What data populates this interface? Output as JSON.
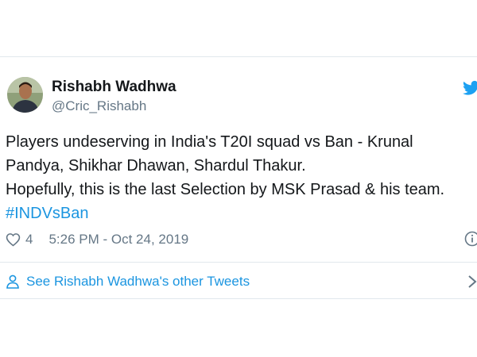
{
  "tweet": {
    "author_name": "Rishabh Wadhwa",
    "handle": "@Cric_Rishabh",
    "text_lines": [
      "Players undeserving in India's T20I squad vs Ban - Krunal",
      "Pandya, Shikhar Dhawan, Shardul Thakur.",
      "Hopefully, this is the last Selection by MSK Prasad & his team."
    ],
    "hashtag": "#INDVsBan",
    "like_count": "4",
    "timestamp": "5:26 PM - Oct 24, 2019",
    "other_tweets_link": "See Rishabh Wadhwa's other Tweets"
  },
  "icons": {
    "brand": "twitter-bird-icon",
    "like": "heart-icon",
    "info": "info-icon",
    "profile": "person-icon",
    "more": "chevron-right-icon"
  },
  "colors": {
    "brand": "#1da1f2",
    "link": "#1b95e0",
    "secondary_text": "#657786",
    "primary_text": "#14171a",
    "border": "#e1e8ed"
  }
}
